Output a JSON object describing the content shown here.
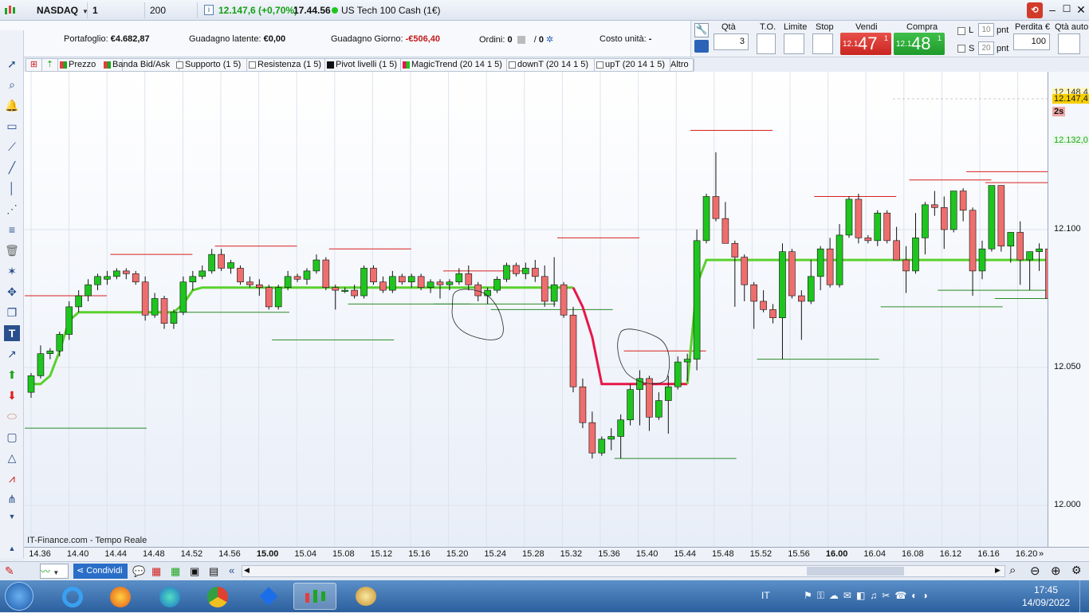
{
  "titlebar": {
    "symbol": "NASDAQ",
    "timeframe": "1 minuto",
    "units": "200 unità",
    "quote": "12.147,6 (+0,70%)",
    "time": "17.44.56",
    "instrument": "US Tech 100 Cash (1€)"
  },
  "portfolio": {
    "portafoglio_label": "Portafoglio:",
    "portafoglio_value": "€4.682,87",
    "latente_label": "Guadagno latente:",
    "latente_value": "€0,00",
    "giorno_label": "Guadagno Giorno:",
    "giorno_value": "-€506,40",
    "ordini_label": "Ordini:",
    "ordini_value": "0",
    "ordini_slash": "/",
    "ordini_value2": "0",
    "costo_label": "Costo unità:",
    "costo_value": "-"
  },
  "trade": {
    "qta_label": "Qtà",
    "qta_value": "3",
    "to_label": "T.O.",
    "limite_label": "Limite",
    "stop_label": "Stop",
    "vendi_label": "Vendi",
    "compra_label": "Compra",
    "sell_prefix": "12.1",
    "sell_big": "47",
    "sell_sup": "1",
    "buy_prefix": "12.1",
    "buy_big": "48",
    "buy_sup": "1",
    "l_label": "L",
    "l_value": "10",
    "s_label": "S",
    "s_value": "20",
    "pnt": "pnt",
    "perdita_label": "Perdita €",
    "perdita_value": "100",
    "qta_auto_label": "Qtà auto"
  },
  "indicators": [
    "Prezzo",
    "Banda Bid/Ask",
    "Supporto (1 5)",
    "Resistenza (1 5)",
    "Pivot livelli (1 5)",
    "MagicTrend (20 14 1 5)",
    "downT (20 14 1 5)",
    "upT (20 14 1 5)",
    "Altro"
  ],
  "chart": {
    "source": "IT-Finance.com - Tempo Reale",
    "price_tag": "12.147,4",
    "timer_tag": "2s",
    "level_tag": "12.132,0",
    "top_tag": "12.148,4",
    "y_ticks": [
      "12.100",
      "12.050",
      "12.000"
    ],
    "x_ticks": [
      "14.36",
      "14.40",
      "14.44",
      "14.48",
      "14.52",
      "14.56",
      "15.00",
      "15.04",
      "15.08",
      "15.12",
      "15.16",
      "15.20",
      "15.24",
      "15.28",
      "15.32",
      "15.36",
      "15.40",
      "15.44",
      "15.48",
      "15.52",
      "15.56",
      "16.00",
      "16.04",
      "16.08",
      "16.12",
      "16.16",
      "16.20"
    ],
    "colors": {
      "up": "#1fc51f",
      "down": "#ee6e6e",
      "magictrend_up": "#5ad12d",
      "magictrend_down": "#e8164a",
      "resistance": "#d92020",
      "support": "#2a8a2a"
    }
  },
  "chart_data": {
    "type": "candlestick",
    "ylim": [
      11996,
      12163
    ],
    "x": [
      "14.35",
      "14.36",
      "14.37",
      "14.38",
      "14.39",
      "14.40",
      "14.41",
      "14.42",
      "14.43",
      "14.44",
      "14.45",
      "14.46",
      "14.47",
      "14.48",
      "14.49",
      "14.50",
      "14.51",
      "14.52",
      "14.53",
      "14.54",
      "14.55",
      "14.56",
      "14.57",
      "14.58",
      "14.59",
      "15.00",
      "15.01",
      "15.02",
      "15.03",
      "15.04",
      "15.05",
      "15.06",
      "15.07",
      "15.08",
      "15.09",
      "15.10",
      "15.11",
      "15.12",
      "15.13",
      "15.14",
      "15.15",
      "15.16",
      "15.17",
      "15.18",
      "15.19",
      "15.20",
      "15.21",
      "15.22",
      "15.23",
      "15.24",
      "15.25",
      "15.26",
      "15.27",
      "15.28",
      "15.29",
      "15.30",
      "15.31",
      "15.32",
      "15.33",
      "15.34",
      "15.35",
      "15.36",
      "15.37",
      "15.38",
      "15.39",
      "15.40",
      "15.41",
      "15.42",
      "15.43",
      "15.44",
      "15.45",
      "15.46",
      "15.47",
      "15.48",
      "15.49",
      "15.50",
      "15.51",
      "15.52",
      "15.53",
      "15.54",
      "15.55",
      "15.56",
      "15.57",
      "15.58",
      "15.59",
      "16.00",
      "16.01",
      "16.02",
      "16.03",
      "16.04",
      "16.05",
      "16.06",
      "16.07",
      "16.08",
      "16.09",
      "16.10",
      "16.11",
      "16.12",
      "16.13",
      "16.14",
      "16.15",
      "16.16",
      "16.17",
      "16.18",
      "16.19",
      "16.20",
      "16.21",
      "16.22"
    ],
    "candles": [
      [
        12041,
        12048,
        12039,
        12047
      ],
      [
        12047,
        12058,
        12046,
        12055
      ],
      [
        12055,
        12057,
        12053,
        12056
      ],
      [
        12056,
        12063,
        12054,
        12062
      ],
      [
        12062,
        12074,
        12060,
        12072
      ],
      [
        12072,
        12078,
        12070,
        12076
      ],
      [
        12076,
        12082,
        12074,
        12080
      ],
      [
        12080,
        12084,
        12078,
        12083
      ],
      [
        12082,
        12085,
        12080,
        12083
      ],
      [
        12083,
        12086,
        12082,
        12085
      ],
      [
        12085,
        12086,
        12082,
        12084
      ],
      [
        12084,
        12085,
        12080,
        12081
      ],
      [
        12081,
        12083,
        12067,
        12069
      ],
      [
        12069,
        12077,
        12068,
        12075
      ],
      [
        12075,
        12076,
        12064,
        12066
      ],
      [
        12066,
        12071,
        12064,
        12070
      ],
      [
        12070,
        12083,
        12069,
        12081
      ],
      [
        12081,
        12085,
        12078,
        12083
      ],
      [
        12083,
        12087,
        12082,
        12085
      ],
      [
        12085,
        12093,
        12084,
        12091
      ],
      [
        12091,
        12093,
        12085,
        12086
      ],
      [
        12086,
        12089,
        12084,
        12088
      ],
      [
        12086,
        12087,
        12080,
        12081
      ],
      [
        12081,
        12083,
        12079,
        12080
      ],
      [
        12080,
        12082,
        12076,
        12079
      ],
      [
        12079,
        12080,
        12071,
        12072
      ],
      [
        12072,
        12080,
        12071,
        12079
      ],
      [
        12079,
        12085,
        12078,
        12083
      ],
      [
        12083,
        12084,
        12081,
        12082
      ],
      [
        12082,
        12086,
        12080,
        12085
      ],
      [
        12085,
        12091,
        12084,
        12089
      ],
      [
        12089,
        12090,
        12078,
        12079
      ],
      [
        12079,
        12080,
        12071,
        12078
      ],
      [
        12078,
        12079,
        12077,
        12078
      ],
      [
        12078,
        12080,
        12075,
        12076
      ],
      [
        12076,
        12087,
        12075,
        12086
      ],
      [
        12086,
        12087,
        12080,
        12081
      ],
      [
        12081,
        12083,
        12077,
        12078
      ],
      [
        12078,
        12085,
        12077,
        12083
      ],
      [
        12083,
        12084,
        12080,
        12081
      ],
      [
        12081,
        12084,
        12079,
        12083
      ],
      [
        12083,
        12084,
        12078,
        12079
      ],
      [
        12079,
        12082,
        12077,
        12081
      ],
      [
        12081,
        12082,
        12075,
        12080
      ],
      [
        12080,
        12082,
        12078,
        12081
      ],
      [
        12081,
        12086,
        12080,
        12084
      ],
      [
        12084,
        12087,
        12078,
        12080
      ],
      [
        12080,
        12081,
        12074,
        12076
      ],
      [
        12076,
        12079,
        12073,
        12078
      ],
      [
        12078,
        12083,
        12077,
        12082
      ],
      [
        12082,
        12088,
        12081,
        12087
      ],
      [
        12087,
        12088,
        12083,
        12084
      ],
      [
        12084,
        12088,
        12082,
        12086
      ],
      [
        12086,
        12089,
        12081,
        12083
      ],
      [
        12083,
        12087,
        12072,
        12074
      ],
      [
        12074,
        12090,
        12072,
        12080
      ],
      [
        12080,
        12081,
        12068,
        12069
      ],
      [
        12069,
        12072,
        12041,
        12043
      ],
      [
        12043,
        12046,
        12028,
        12030
      ],
      [
        12030,
        12034,
        12017,
        12019
      ],
      [
        12019,
        12025,
        12018,
        12024
      ],
      [
        12024,
        12028,
        12020,
        12025
      ],
      [
        12025,
        12033,
        12017,
        12031
      ],
      [
        12031,
        12044,
        12029,
        12042
      ],
      [
        12042,
        12049,
        12029,
        12046
      ],
      [
        12046,
        12047,
        12027,
        12032
      ],
      [
        12032,
        12041,
        12031,
        12038
      ],
      [
        12038,
        12047,
        12026,
        12043
      ],
      [
        12043,
        12054,
        12042,
        12052
      ],
      [
        12052,
        12055,
        12045,
        12053
      ],
      [
        12053,
        12100,
        12049,
        12096
      ],
      [
        12096,
        12113,
        12095,
        12112
      ],
      [
        12112,
        12128,
        12103,
        12104
      ],
      [
        12104,
        12110,
        12095,
        12095
      ],
      [
        12095,
        12096,
        12072,
        12090
      ],
      [
        12090,
        12091,
        12074,
        12080
      ],
      [
        12080,
        12081,
        12064,
        12074
      ],
      [
        12074,
        12078,
        12070,
        12071
      ],
      [
        12071,
        12073,
        12066,
        12068
      ],
      [
        12068,
        12095,
        12053,
        12092
      ],
      [
        12092,
        12093,
        12075,
        12076
      ],
      [
        12076,
        12078,
        12060,
        12074
      ],
      [
        12074,
        12089,
        12073,
        12083
      ],
      [
        12083,
        12094,
        12078,
        12093
      ],
      [
        12093,
        12097,
        12079,
        12080
      ],
      [
        12080,
        12102,
        12079,
        12098
      ],
      [
        12098,
        12112,
        12097,
        12111
      ],
      [
        12111,
        12113,
        12095,
        12097
      ],
      [
        12097,
        12098,
        12095,
        12096
      ],
      [
        12096,
        12107,
        12094,
        12106
      ],
      [
        12106,
        12107,
        12095,
        12096
      ],
      [
        12096,
        12101,
        12093,
        12089
      ],
      [
        12089,
        12094,
        12077,
        12085
      ],
      [
        12085,
        12106,
        12084,
        12097
      ],
      [
        12097,
        12110,
        12091,
        12109
      ],
      [
        12109,
        12114,
        12105,
        12108
      ],
      [
        12108,
        12112,
        12093,
        12100
      ],
      [
        12100,
        12113,
        12099,
        12114
      ],
      [
        12114,
        12115,
        12103,
        12107
      ],
      [
        12107,
        12108,
        12076,
        12085
      ],
      [
        12085,
        12096,
        12082,
        12093
      ],
      [
        12093,
        12102,
        12092,
        12116
      ],
      [
        12116,
        12115,
        12092,
        12094
      ],
      [
        12094,
        12099,
        12088,
        12099
      ],
      [
        12099,
        12103,
        12080,
        12089
      ],
      [
        12089,
        12091,
        12078,
        12092
      ],
      [
        12092,
        12095,
        12085,
        12093
      ],
      [
        12093,
        12098,
        12075,
        12075
      ],
      [
        12075,
        12080,
        12072,
        12074
      ]
    ],
    "magictrend": [
      [
        12044,
        12044,
        12047,
        12056,
        12067,
        12070,
        12070,
        12070,
        12070,
        12070,
        12070,
        12070,
        12070,
        12070,
        12070,
        12070,
        12073,
        12078,
        12079,
        12079,
        12079,
        12079,
        12079,
        12079,
        12079,
        12079,
        12079,
        12079,
        12079,
        12079,
        12079,
        12079,
        12079,
        12079,
        12079,
        12079,
        12079,
        12079,
        12079,
        12079,
        12079,
        12079,
        12079,
        12079,
        12079,
        12079,
        12079,
        12079,
        12079,
        12079,
        12079,
        12079,
        12079,
        12079,
        12079,
        12079,
        12079,
        12079
      ],
      [
        12079,
        12072,
        12061,
        12044,
        12044,
        12044,
        12044,
        12044,
        12044,
        12044,
        12044,
        12044,
        12044
      ],
      [
        12044,
        12080,
        12089,
        12089,
        12089,
        12089,
        12089,
        12089,
        12089,
        12089,
        12089,
        12089,
        12089,
        12089,
        12089,
        12089,
        12089,
        12089,
        12089,
        12089,
        12089,
        12089,
        12089,
        12089,
        12089,
        12089,
        12089,
        12089,
        12089,
        12089,
        12089,
        12089,
        12089,
        12089,
        12089,
        12089,
        12089,
        12089,
        12089
      ]
    ],
    "resistance_levels": [
      12076,
      12091,
      12094,
      12093,
      12085,
      12097,
      12056,
      12136,
      12112,
      12118,
      12121,
      12117
    ],
    "support_levels": [
      12028,
      12070,
      12060,
      12073,
      12073,
      12071,
      12017,
      12053,
      12072,
      12078,
      12075
    ]
  },
  "bottom": {
    "share_label": "Condividi"
  },
  "taskbar": {
    "lang": "IT",
    "clock_time": "17:45",
    "clock_date": "14/09/2022"
  }
}
